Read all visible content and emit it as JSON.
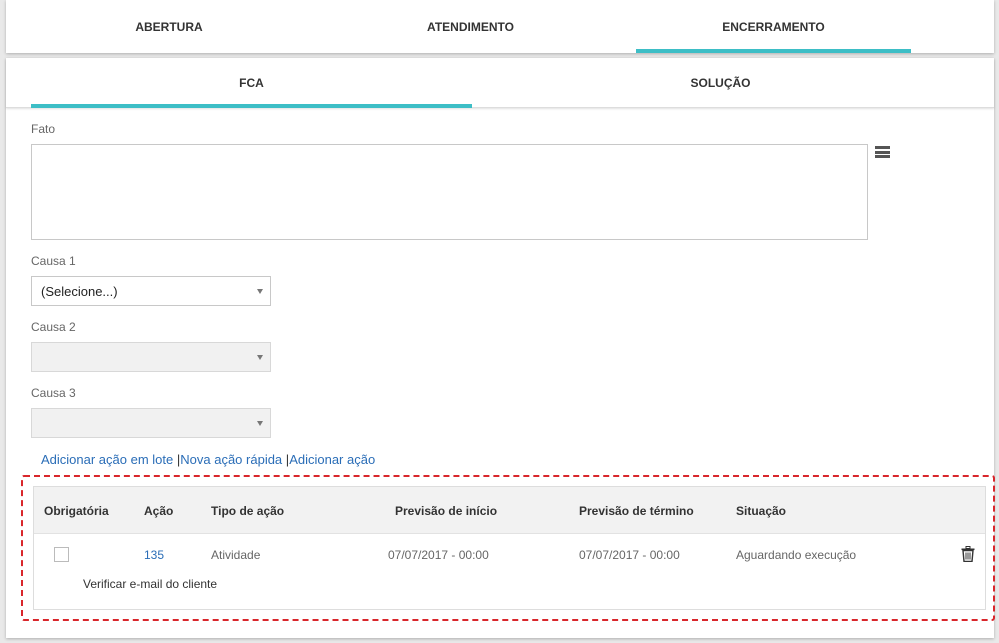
{
  "top_tabs": [
    {
      "label": "ABERTURA",
      "active": false
    },
    {
      "label": "ATENDIMENTO",
      "active": false
    },
    {
      "label": "ENCERRAMENTO",
      "active": true
    }
  ],
  "sub_tabs": [
    {
      "label": "FCA",
      "active": true
    },
    {
      "label": "SOLUÇÃO",
      "active": false
    }
  ],
  "form": {
    "fato_label": "Fato",
    "fato_value": "",
    "causa1_label": "Causa 1",
    "causa1_value": "(Selecione...)",
    "causa2_label": "Causa 2",
    "causa2_value": "",
    "causa3_label": "Causa 3",
    "causa3_value": ""
  },
  "links": {
    "add_batch": "Adicionar ação em lote",
    "quick_action": "Nova ação rápida",
    "add_action": "Adicionar ação",
    "separator": "|"
  },
  "table": {
    "headers": [
      "Obrigatória",
      "Ação",
      "Tipo de ação",
      "Previsão de início",
      "Previsão de término",
      "Situação"
    ],
    "rows": [
      {
        "obrigatoria": false,
        "acao": "135",
        "tipo": "Atividade",
        "inicio": "07/07/2017 - 00:00",
        "termino": "07/07/2017 - 00:00",
        "situacao": "Aguardando execução",
        "descricao": "Verificar e-mail do cliente"
      }
    ]
  },
  "colors": {
    "accent": "#3dbec6",
    "link": "#2a6db7",
    "highlight_border": "#d9262b"
  },
  "icons": {
    "fato_menu": "menu-lines-icon",
    "delete": "trash-icon",
    "dropdown": "caret-down-icon"
  }
}
